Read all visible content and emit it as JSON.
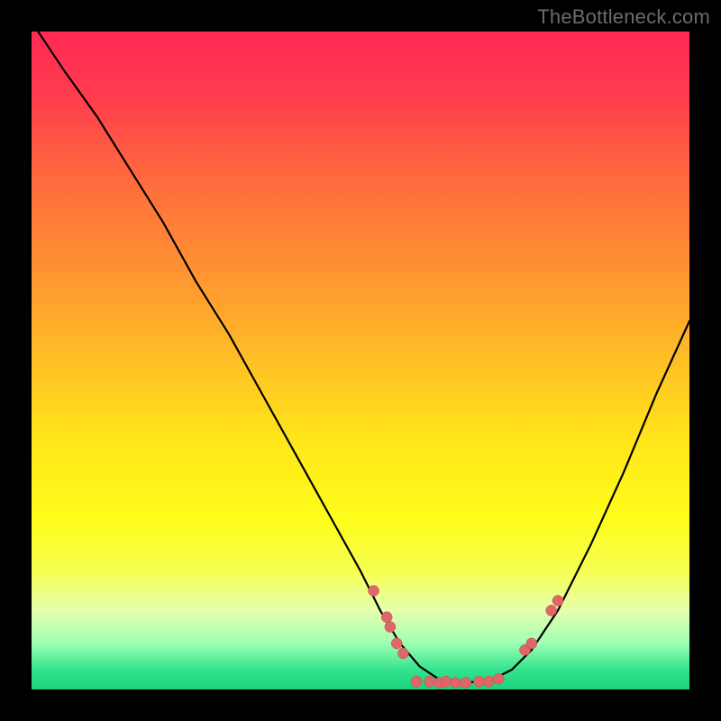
{
  "watermark": "TheBottleneck.com",
  "colors": {
    "background": "#000000",
    "curve": "#000000",
    "marker": "#e06767",
    "markerStroke": "#b84a4a"
  },
  "gradient_stops": [
    {
      "offset": 0.0,
      "color": "#ff2a55"
    },
    {
      "offset": 0.1,
      "color": "#ff3d4d"
    },
    {
      "offset": 0.22,
      "color": "#ff6a3f"
    },
    {
      "offset": 0.35,
      "color": "#ff8f33"
    },
    {
      "offset": 0.5,
      "color": "#ffbf25"
    },
    {
      "offset": 0.62,
      "color": "#ffe61a"
    },
    {
      "offset": 0.74,
      "color": "#fffd1a"
    },
    {
      "offset": 0.82,
      "color": "#f6ff52"
    },
    {
      "offset": 0.88,
      "color": "#e6ffb0"
    },
    {
      "offset": 0.93,
      "color": "#9effb4"
    },
    {
      "offset": 0.97,
      "color": "#35e38e"
    },
    {
      "offset": 1.0,
      "color": "#1ad37c"
    }
  ],
  "chart_data": {
    "type": "line",
    "title": "",
    "xlabel": "",
    "ylabel": "",
    "xlim": [
      0,
      100
    ],
    "ylim": [
      0,
      100
    ],
    "curve": [
      {
        "x": 1,
        "y": 100
      },
      {
        "x": 5,
        "y": 94
      },
      {
        "x": 10,
        "y": 87
      },
      {
        "x": 15,
        "y": 79
      },
      {
        "x": 20,
        "y": 71
      },
      {
        "x": 25,
        "y": 62
      },
      {
        "x": 30,
        "y": 54
      },
      {
        "x": 35,
        "y": 45
      },
      {
        "x": 40,
        "y": 36
      },
      {
        "x": 45,
        "y": 27
      },
      {
        "x": 50,
        "y": 18
      },
      {
        "x": 53,
        "y": 12
      },
      {
        "x": 56,
        "y": 7
      },
      {
        "x": 59,
        "y": 3.5
      },
      {
        "x": 62,
        "y": 1.5
      },
      {
        "x": 66,
        "y": 1.0
      },
      {
        "x": 70,
        "y": 1.5
      },
      {
        "x": 73,
        "y": 3
      },
      {
        "x": 76,
        "y": 6
      },
      {
        "x": 80,
        "y": 12
      },
      {
        "x": 85,
        "y": 22
      },
      {
        "x": 90,
        "y": 33
      },
      {
        "x": 95,
        "y": 45
      },
      {
        "x": 100,
        "y": 56
      }
    ],
    "markers": [
      {
        "x": 52.0,
        "y": 15.0
      },
      {
        "x": 54.0,
        "y": 11.0
      },
      {
        "x": 54.5,
        "y": 9.5
      },
      {
        "x": 55.5,
        "y": 7.0
      },
      {
        "x": 56.5,
        "y": 5.5
      },
      {
        "x": 58.5,
        "y": 1.2
      },
      {
        "x": 60.5,
        "y": 1.2
      },
      {
        "x": 62.0,
        "y": 1.0
      },
      {
        "x": 63.0,
        "y": 1.2
      },
      {
        "x": 64.5,
        "y": 1.0
      },
      {
        "x": 66.0,
        "y": 1.0
      },
      {
        "x": 68.0,
        "y": 1.2
      },
      {
        "x": 69.5,
        "y": 1.2
      },
      {
        "x": 71.0,
        "y": 1.6
      },
      {
        "x": 75.0,
        "y": 6.0
      },
      {
        "x": 76.0,
        "y": 7.0
      },
      {
        "x": 79.0,
        "y": 12.0
      },
      {
        "x": 80.0,
        "y": 13.5
      }
    ]
  }
}
